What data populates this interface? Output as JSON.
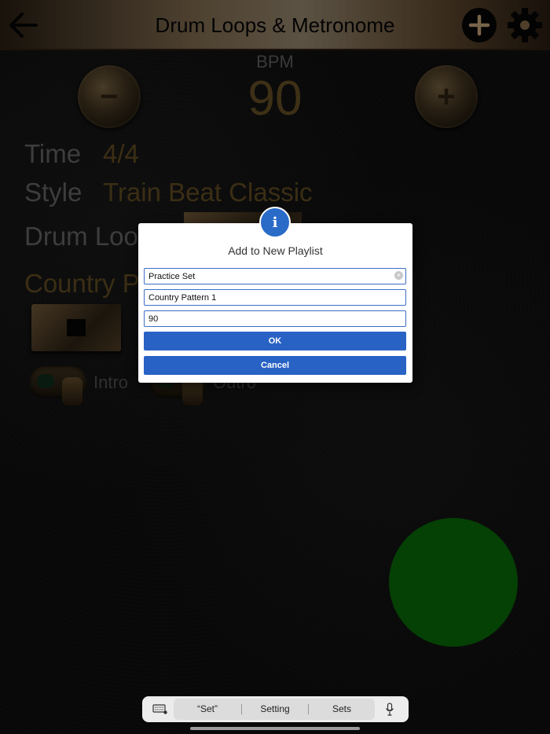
{
  "header": {
    "title": "Drum Loops & Metronome",
    "back_icon": "arrow-left-icon",
    "add_icon": "plus-circle-icon",
    "settings_icon": "gear-icon"
  },
  "tempo": {
    "label": "BPM",
    "value": "90",
    "minus_symbol": "−",
    "plus_symbol": "+"
  },
  "rows": {
    "time_label": "Time",
    "time_value": "4/4",
    "style_label": "Style",
    "style_value": "Train Beat Classic",
    "drum_loop_label": "Drum Loo",
    "pattern_value": "Country P"
  },
  "toggles": {
    "intro_label": "Intro",
    "outro_label": "Outro"
  },
  "dialog": {
    "badge": "i",
    "title": "Add to New Playlist",
    "playlist_name_value": "Practice Set",
    "pattern_value": "Country Pattern 1",
    "bpm_value": "90",
    "ok_label": "OK",
    "cancel_label": "Cancel"
  },
  "keyboard_bar": {
    "suggestions": [
      "“Set”",
      "Setting",
      "Sets"
    ],
    "keyboard_icon": "keyboard-icon",
    "mic_icon": "microphone-icon"
  },
  "colors": {
    "accent_blue": "#2862c4",
    "go_green": "#086308",
    "gold_text": "#5b4820"
  }
}
